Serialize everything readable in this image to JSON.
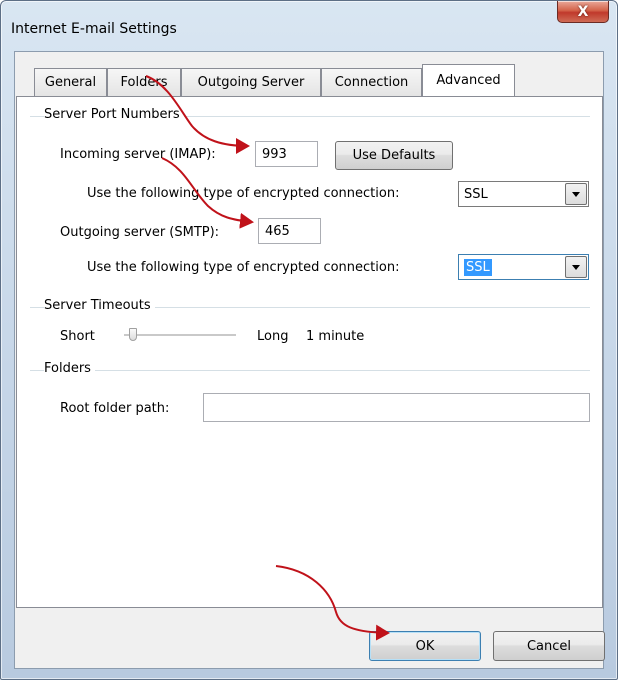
{
  "window": {
    "title": "Internet E-mail Settings",
    "close_label": "X"
  },
  "tabs": [
    {
      "label": "General",
      "active": false
    },
    {
      "label": "Folders",
      "active": false
    },
    {
      "label": "Outgoing Server",
      "active": false
    },
    {
      "label": "Connection",
      "active": false
    },
    {
      "label": "Advanced",
      "active": true
    }
  ],
  "server_ports": {
    "group_label": "Server Port Numbers",
    "incoming_label": "Incoming server (IMAP):",
    "incoming_value": "993",
    "use_defaults_label": "Use Defaults",
    "incoming_encryption_label": "Use the following type of encrypted connection:",
    "incoming_encryption_value": "SSL",
    "outgoing_label": "Outgoing server (SMTP):",
    "outgoing_value": "465",
    "outgoing_encryption_label": "Use the following type of encrypted connection:",
    "outgoing_encryption_value": "SSL"
  },
  "timeouts": {
    "group_label": "Server Timeouts",
    "short_label": "Short",
    "long_label": "Long",
    "value_label": "1 minute",
    "slider_fraction": 0.05
  },
  "folders": {
    "group_label": "Folders",
    "root_label": "Root folder path:",
    "root_value": ""
  },
  "buttons": {
    "ok_label": "OK",
    "cancel_label": "Cancel"
  },
  "colors": {
    "annotation_arrow": "#c0121a",
    "selection": "#3399ff"
  }
}
